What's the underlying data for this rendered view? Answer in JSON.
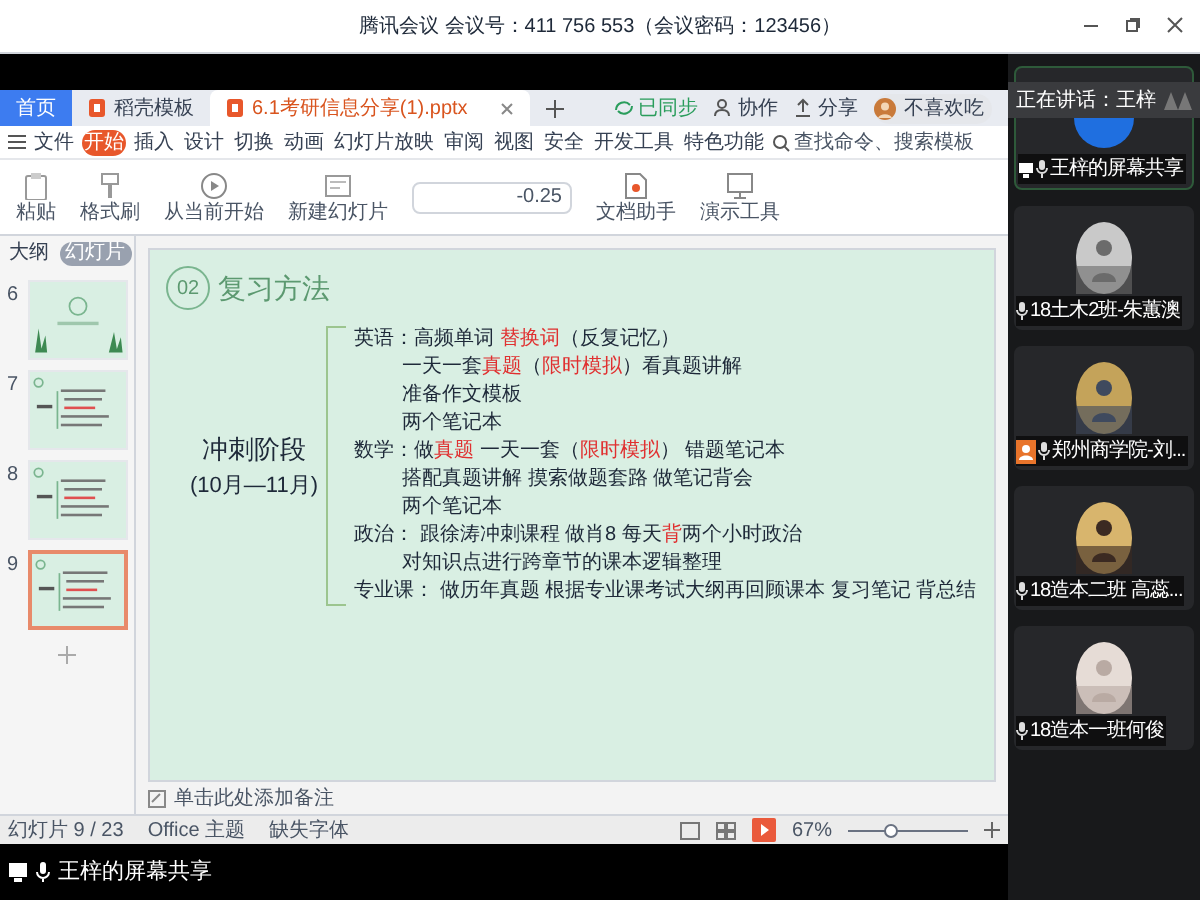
{
  "meeting": {
    "title": "腾讯会议 会议号：411 756 553（会议密码：123456）"
  },
  "wps": {
    "tabs": [
      {
        "label": "首页",
        "selected": false,
        "kind": "home"
      },
      {
        "label": "稻壳模板",
        "selected": false,
        "kind": "docer"
      },
      {
        "label": "6.1考研信息分享(1).pptx",
        "selected": true,
        "kind": "file"
      }
    ],
    "actions": [
      "已同步",
      "协作",
      "分享"
    ],
    "user": "不喜欢吃",
    "menu": [
      {
        "label": "文件",
        "selected": false
      },
      {
        "label": "开始",
        "selected": true
      },
      {
        "label": "插入",
        "selected": false
      },
      {
        "label": "设计",
        "selected": false
      },
      {
        "label": "切换",
        "selected": false
      },
      {
        "label": "动画",
        "selected": false
      },
      {
        "label": "幻灯片放映",
        "selected": false
      },
      {
        "label": "审阅",
        "selected": false
      },
      {
        "label": "视图",
        "selected": false
      },
      {
        "label": "安全",
        "selected": false
      },
      {
        "label": "开发工具",
        "selected": false
      },
      {
        "label": "特色功能",
        "selected": false
      }
    ],
    "search": {
      "placeholder": "查找命令、搜索模板"
    },
    "ribbon": [
      {
        "label": "粘贴",
        "kind": "paste"
      },
      {
        "label": "格式刷",
        "kind": "brush"
      },
      {
        "label": "从当前开始",
        "kind": "play"
      },
      {
        "label": "新建幻灯片",
        "kind": "slide"
      },
      {
        "label": "-0.25",
        "kind": "field"
      },
      {
        "label": "文档助手",
        "kind": "doc"
      },
      {
        "label": "演示工具",
        "kind": "tool"
      }
    ],
    "panel_tabs": [
      {
        "label": "大纲",
        "selected": false
      },
      {
        "label": "幻灯片",
        "selected": true
      }
    ],
    "thumbnails": [
      {
        "number": "6",
        "selected": false,
        "kind": "cover"
      },
      {
        "number": "7",
        "selected": false,
        "kind": "content"
      },
      {
        "number": "8",
        "selected": false,
        "kind": "content"
      },
      {
        "number": "9",
        "selected": true,
        "kind": "content"
      }
    ],
    "slide": {
      "badge": "02",
      "heading": "复习方法",
      "stage": "冲刺阶段",
      "period": "(10月—11月)",
      "lines": [
        {
          "kind": "subject",
          "segments": [
            {
              "text": "英语：高频单词 ",
              "emphasis": false
            },
            {
              "text": "替换词",
              "emphasis": true
            },
            {
              "text": "（反复记忆）",
              "emphasis": false
            }
          ]
        },
        {
          "kind": "detail",
          "segments": [
            {
              "text": "一天一套",
              "emphasis": false
            },
            {
              "text": "真题",
              "emphasis": true
            },
            {
              "text": "（",
              "emphasis": false
            },
            {
              "text": "限时模拟",
              "emphasis": true
            },
            {
              "text": "）看真题讲解",
              "emphasis": false
            }
          ]
        },
        {
          "kind": "detail",
          "segments": [
            {
              "text": "准备作文模板",
              "emphasis": false
            }
          ]
        },
        {
          "kind": "detail",
          "segments": [
            {
              "text": "两个笔记本",
              "emphasis": false
            }
          ]
        },
        {
          "kind": "subject",
          "segments": [
            {
              "text": "数学：做",
              "emphasis": false
            },
            {
              "text": "真题",
              "emphasis": true
            },
            {
              "text": " 一天一套（",
              "emphasis": false
            },
            {
              "text": "限时模拟",
              "emphasis": true
            },
            {
              "text": "） 错题笔记本",
              "emphasis": false
            }
          ]
        },
        {
          "kind": "detail",
          "segments": [
            {
              "text": "搭配真题讲解 摸索做题套路 做笔记背会",
              "emphasis": false
            }
          ]
        },
        {
          "kind": "detail",
          "segments": [
            {
              "text": "两个笔记本",
              "emphasis": false
            }
          ]
        },
        {
          "kind": "subject",
          "segments": [
            {
              "text": "政治： 跟徐涛冲刺课程 做肖8 每天",
              "emphasis": false
            },
            {
              "text": "背",
              "emphasis": true
            },
            {
              "text": "两个小时政治",
              "emphasis": false
            }
          ]
        },
        {
          "kind": "detail",
          "segments": [
            {
              "text": "对知识点进行跨章节的课本逻辑整理",
              "emphasis": false
            }
          ]
        },
        {
          "kind": "subject",
          "segments": [
            {
              "text": "专业课： 做历年真题 根据专业课考试大纲再回顾课本 复习笔记 背总结",
              "emphasis": false
            }
          ]
        }
      ]
    },
    "notes_placeholder": "单击此处添加备注",
    "status": {
      "slide_count": "幻灯片 9 / 23",
      "theme": "Office 主题",
      "missing_fonts": "缺失字体",
      "zoom": "67%",
      "zoom_slider": {
        "level": 0.35
      }
    }
  },
  "share_label": "王梓的屏幕共享",
  "speaking": "正在讲话：王梓",
  "participants": [
    {
      "name": "王梓的屏幕共享",
      "kind": "screen",
      "host": false
    },
    {
      "name": "18土木2班-朱蕙澳",
      "kind": "video",
      "host": false
    },
    {
      "name": "郑州商学院-刘...",
      "kind": "video",
      "host": true
    },
    {
      "name": "18造本二班 高蕊...",
      "kind": "video",
      "host": false
    },
    {
      "name": "18造本一班何俊",
      "kind": "video",
      "host": false
    }
  ]
}
